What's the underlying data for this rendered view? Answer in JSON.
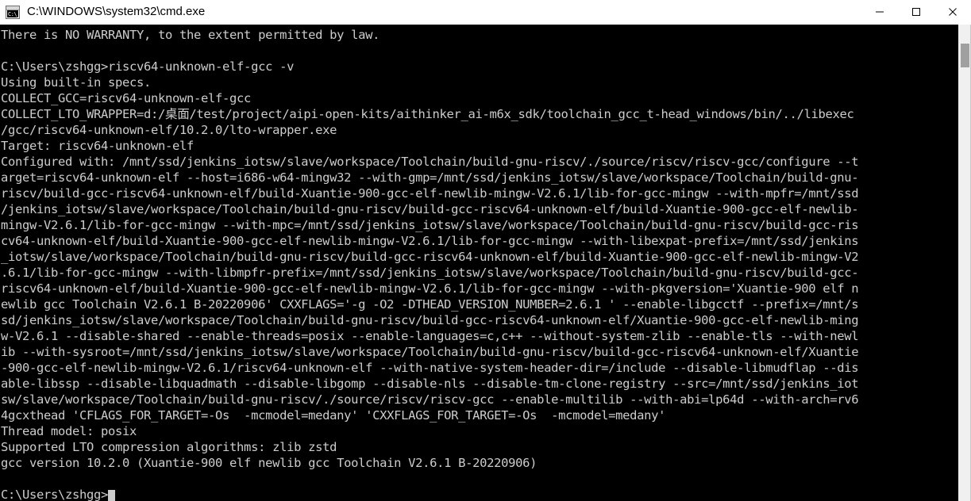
{
  "window": {
    "title": "C:\\WINDOWS\\system32\\cmd.exe",
    "icon": "cmd-console-icon",
    "icon_glyph": "C:\\_",
    "controls": {
      "minimize": "minimize-button",
      "maximize": "maximize-button",
      "close": "close-button"
    },
    "colors": {
      "titlebar_bg": "#ffffff",
      "titlebar_fg": "#000000",
      "console_bg": "#000000",
      "console_fg": "#cccccc",
      "scrollbar_track": "#f0f0f0",
      "scrollbar_thumb": "#a0a0a0"
    }
  },
  "scrollbar": {
    "thumb_top_pct": 4,
    "thumb_height_pct": 5
  },
  "console": {
    "prompt": "C:\\Users\\zshgg>",
    "command": "riscv64-unknown-elf-gcc -v",
    "cursor_visible": true,
    "lines": [
      "There is NO WARRANTY, to the extent permitted by law.",
      "",
      "C:\\Users\\zshgg>riscv64-unknown-elf-gcc -v",
      "Using built-in specs.",
      "COLLECT_GCC=riscv64-unknown-elf-gcc",
      "COLLECT_LTO_WRAPPER=d:/桌面/test/project/aipi-open-kits/aithinker_ai-m6x_sdk/toolchain_gcc_t-head_windows/bin/../libexec",
      "/gcc/riscv64-unknown-elf/10.2.0/lto-wrapper.exe",
      "Target: riscv64-unknown-elf",
      "Configured with: /mnt/ssd/jenkins_iotsw/slave/workspace/Toolchain/build-gnu-riscv/./source/riscv/riscv-gcc/configure --t",
      "arget=riscv64-unknown-elf --host=i686-w64-mingw32 --with-gmp=/mnt/ssd/jenkins_iotsw/slave/workspace/Toolchain/build-gnu-",
      "riscv/build-gcc-riscv64-unknown-elf/build-Xuantie-900-gcc-elf-newlib-mingw-V2.6.1/lib-for-gcc-mingw --with-mpfr=/mnt/ssd",
      "/jenkins_iotsw/slave/workspace/Toolchain/build-gnu-riscv/build-gcc-riscv64-unknown-elf/build-Xuantie-900-gcc-elf-newlib-",
      "mingw-V2.6.1/lib-for-gcc-mingw --with-mpc=/mnt/ssd/jenkins_iotsw/slave/workspace/Toolchain/build-gnu-riscv/build-gcc-ris",
      "cv64-unknown-elf/build-Xuantie-900-gcc-elf-newlib-mingw-V2.6.1/lib-for-gcc-mingw --with-libexpat-prefix=/mnt/ssd/jenkins",
      "_iotsw/slave/workspace/Toolchain/build-gnu-riscv/build-gcc-riscv64-unknown-elf/build-Xuantie-900-gcc-elf-newlib-mingw-V2",
      ".6.1/lib-for-gcc-mingw --with-libmpfr-prefix=/mnt/ssd/jenkins_iotsw/slave/workspace/Toolchain/build-gnu-riscv/build-gcc-",
      "riscv64-unknown-elf/build-Xuantie-900-gcc-elf-newlib-mingw-V2.6.1/lib-for-gcc-mingw --with-pkgversion='Xuantie-900 elf n",
      "ewlib gcc Toolchain V2.6.1 B-20220906' CXXFLAGS='-g -O2 -DTHEAD_VERSION_NUMBER=2.6.1 ' --enable-libgcctf --prefix=/mnt/s",
      "sd/jenkins_iotsw/slave/workspace/Toolchain/build-gnu-riscv/build-gcc-riscv64-unknown-elf/Xuantie-900-gcc-elf-newlib-ming",
      "w-V2.6.1 --disable-shared --enable-threads=posix --enable-languages=c,c++ --without-system-zlib --enable-tls --with-newl",
      "ib --with-sysroot=/mnt/ssd/jenkins_iotsw/slave/workspace/Toolchain/build-gnu-riscv/build-gcc-riscv64-unknown-elf/Xuantie",
      "-900-gcc-elf-newlib-mingw-V2.6.1/riscv64-unknown-elf --with-native-system-header-dir=/include --disable-libmudflap --dis",
      "able-libssp --disable-libquadmath --disable-libgomp --disable-nls --disable-tm-clone-registry --src=/mnt/ssd/jenkins_iot",
      "sw/slave/workspace/Toolchain/build-gnu-riscv/./source/riscv/riscv-gcc --enable-multilib --with-abi=lp64d --with-arch=rv6",
      "4gcxthead 'CFLAGS_FOR_TARGET=-Os  -mcmodel=medany' 'CXXFLAGS_FOR_TARGET=-Os  -mcmodel=medany'",
      "Thread model: posix",
      "Supported LTO compression algorithms: zlib zstd",
      "gcc version 10.2.0 (Xuantie-900 elf newlib gcc Toolchain V2.6.1 B-20220906)",
      "",
      "C:\\Users\\zshgg>"
    ]
  }
}
